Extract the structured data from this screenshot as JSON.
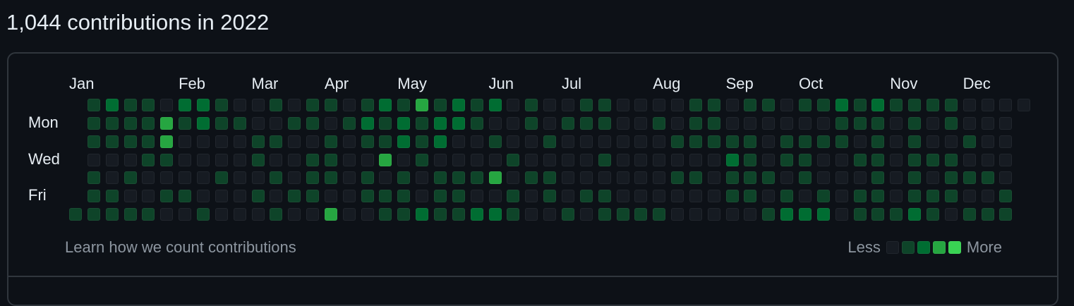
{
  "heading": "1,044 contributions in 2022",
  "months": [
    {
      "label": "Jan",
      "week": 0
    },
    {
      "label": "Feb",
      "week": 6
    },
    {
      "label": "Mar",
      "week": 10
    },
    {
      "label": "Apr",
      "week": 14
    },
    {
      "label": "May",
      "week": 18
    },
    {
      "label": "Jun",
      "week": 23
    },
    {
      "label": "Jul",
      "week": 27
    },
    {
      "label": "Aug",
      "week": 32
    },
    {
      "label": "Sep",
      "week": 36
    },
    {
      "label": "Oct",
      "week": 40
    },
    {
      "label": "Nov",
      "week": 45
    },
    {
      "label": "Dec",
      "week": 49
    }
  ],
  "day_labels": [
    {
      "label": "Mon",
      "row": 1
    },
    {
      "label": "Wed",
      "row": 3
    },
    {
      "label": "Fri",
      "row": 5
    }
  ],
  "level_colors": [
    "#161b22",
    "#0e4429",
    "#006d32",
    "#26a641",
    "#39d353"
  ],
  "contributions": {
    "weeks": 53,
    "first_week_start_row": 6,
    "last_week_end_row": 0,
    "levels_by_row": [
      "01211022100101101213121201001100001101101121211110000001",
      "01111312110011012121221001011100101100000011101010001011",
      "01111300001100101121200100100000011111011110101001001011",
      "00001100001001100301000010000100000021011001101110000010",
      "01010000100101101010111301100000011011101000101011101100",
      "01100110001011001110110010101100000011010101101110010100",
      "11111001000100300112112210010111100000122201112101110100"
    ]
  },
  "footer": {
    "learn_link": "Learn how we count contributions",
    "less_label": "Less",
    "more_label": "More"
  }
}
